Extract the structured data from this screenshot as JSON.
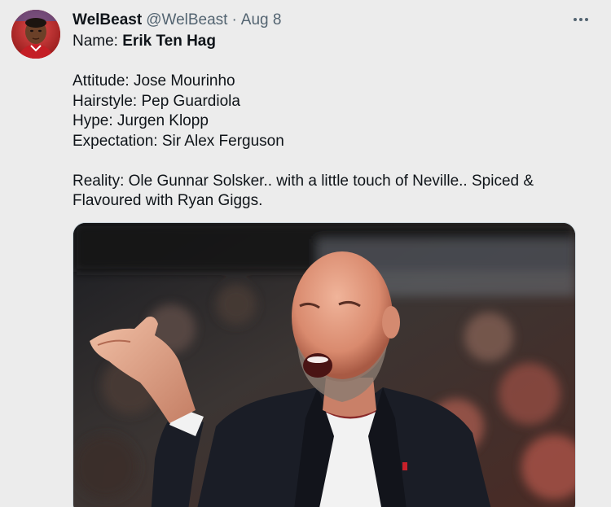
{
  "tweet": {
    "author": {
      "display_name": "WelBeast",
      "handle": "@WelBeast",
      "avatar_icon": "avatar-photo"
    },
    "separator": "·",
    "timestamp": "Aug 8",
    "more_icon": "more-horizontal-icon",
    "text": {
      "name_label": "Name: ",
      "name_value": "Erik Ten Hag",
      "line_attitude": "Attitude: Jose Mourinho",
      "line_hairstyle": "Hairstyle: Pep Guardiola",
      "line_hype": "Hype: Jurgen Klopp",
      "line_expectation": "Expectation: Sir Alex Ferguson",
      "line_reality_1": "Reality: Ole Gunnar Solsker.. with a little touch of Neville.. Spiced &",
      "line_reality_2": "Flavoured with Ryan Giggs."
    },
    "media": {
      "type": "photo"
    }
  },
  "colors": {
    "background": "#ececec",
    "text_primary": "#0f1419",
    "text_secondary": "#536471"
  }
}
